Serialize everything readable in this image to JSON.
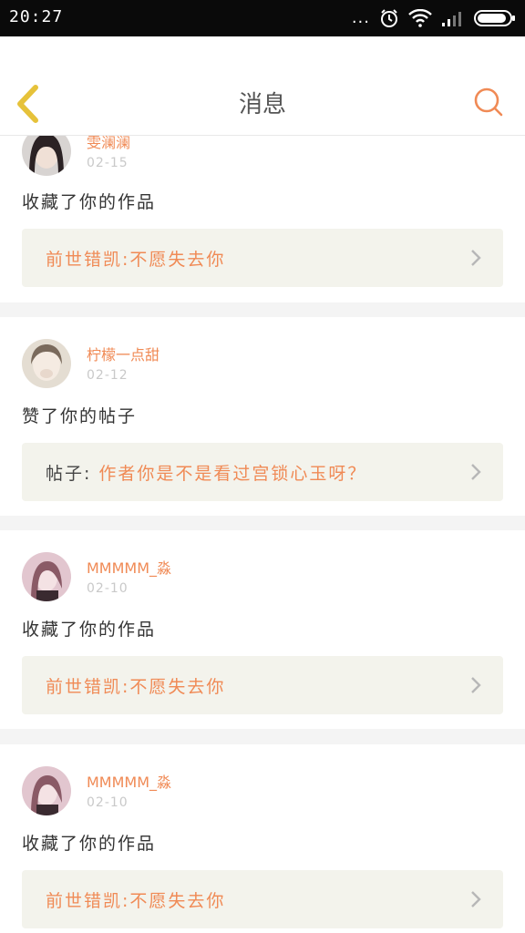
{
  "status_bar": {
    "time": "20:27",
    "more": "..."
  },
  "header": {
    "title": "消息"
  },
  "notifications": [
    {
      "user": "雯澜澜",
      "date": "02-15",
      "action": "收藏了你的作品",
      "ref_prefix": "",
      "ref_title": "前世错凯:不愿失去你"
    },
    {
      "user": "柠檬一点甜",
      "date": "02-12",
      "action": "赞了你的帖子",
      "ref_prefix": "帖子:",
      "ref_title": "作者你是不是看过宫锁心玉呀？"
    },
    {
      "user": "MMMMM_淼",
      "date": "02-10",
      "action": "收藏了你的作品",
      "ref_prefix": "",
      "ref_title": "前世错凯:不愿失去你"
    },
    {
      "user": "MMMMM_淼",
      "date": "02-10",
      "action": "收藏了你的作品",
      "ref_prefix": "",
      "ref_title": "前世错凯:不愿失去你"
    }
  ],
  "colors": {
    "accent": "#f08a55",
    "back_icon": "#e6c23a",
    "ref_bg": "#f3f3ec"
  }
}
